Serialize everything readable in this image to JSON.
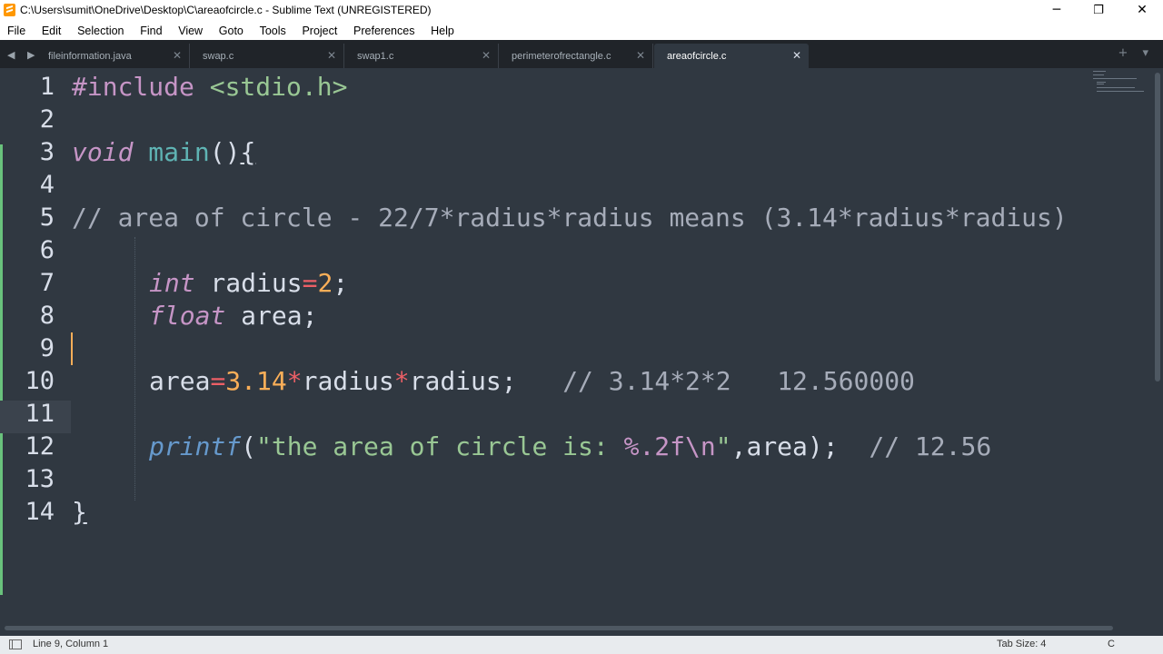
{
  "window": {
    "title": "C:\\Users\\sumit\\OneDrive\\Desktop\\C\\areaofcircle.c - Sublime Text (UNREGISTERED)",
    "minimize": "─",
    "maximize": "❐",
    "close": "✕"
  },
  "menu": [
    "File",
    "Edit",
    "Selection",
    "Find",
    "View",
    "Goto",
    "Tools",
    "Project",
    "Preferences",
    "Help"
  ],
  "tabs": [
    {
      "label": "fileinformation.java",
      "close": "✕"
    },
    {
      "label": "swap.c",
      "close": "✕"
    },
    {
      "label": "swap1.c",
      "close": "✕"
    },
    {
      "label": "perimeterofrectangle.c",
      "close": "✕"
    },
    {
      "label": "areaofcircle.c",
      "close": "✕"
    }
  ],
  "tab_nav": "◀ ▶",
  "tab_tools": "+ ▾",
  "editor": {
    "line_numbers": [
      "1",
      "2",
      "3",
      "4",
      "5",
      "6",
      "7",
      "8",
      "9",
      "10",
      "11",
      "12",
      "13",
      "14"
    ],
    "code": {
      "l1_pre": "#include",
      "l1_inc": " <stdio.h>",
      "l3_kw": "void",
      "l3_fn": " main",
      "l3_rest": "()",
      "l3_brace": "{",
      "l5_cmt": "// area of circle - 22/7*radius*radius means (3.14*radius*radius)",
      "l7_kw": "int",
      "l7_var": " radius",
      "l7_op": "=",
      "l7_num": "2",
      "l7_end": ";",
      "l8_kw": "float",
      "l8_rest": " area;",
      "l10_var": "area",
      "l10_op": "=",
      "l10_num": "3.14",
      "l10_op2": "*",
      "l10_v2": "radius",
      "l10_op3": "*",
      "l10_v3": "radius;",
      "l10_cmt": "   // 3.14*2*2   12.560000",
      "l12_call": "printf",
      "l12_p1": "(",
      "l12_str1": "\"the area of circle is: ",
      "l12_fmt": "%.2f\\n",
      "l12_str2": "\"",
      "l12_rest": ",area);",
      "l12_cmt": "  // 12.56",
      "l14_brace": "}"
    }
  },
  "status": {
    "position": "Line 9, Column 1",
    "tab_size": "Tab Size: 4",
    "syntax": "C"
  },
  "colors": {
    "background": "#303841",
    "keyword": "#c695c6",
    "function": "#5fb4b4",
    "number": "#f9ae58",
    "operator": "#ec5f66",
    "string": "#99c794",
    "comment": "#a6acb9"
  }
}
